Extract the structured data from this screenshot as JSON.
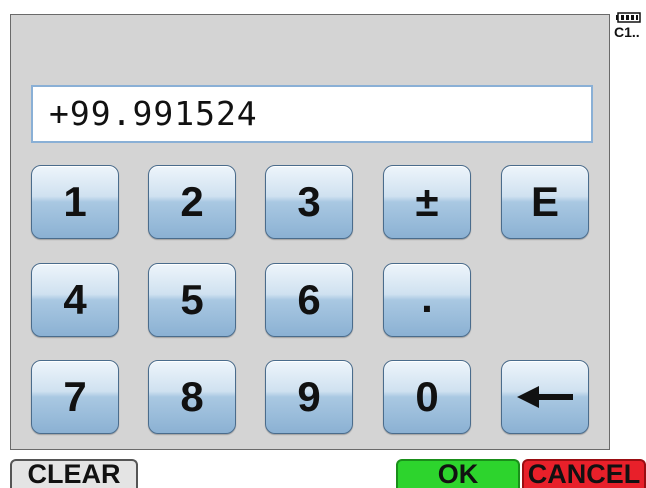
{
  "display": {
    "value": "+99.991524"
  },
  "keypad": {
    "k1": "1",
    "k2": "2",
    "k3": "3",
    "sign": "±",
    "exp": "E",
    "k4": "4",
    "k5": "5",
    "k6": "6",
    "dot": ".",
    "k7": "7",
    "k8": "8",
    "k9": "9",
    "k0": "0"
  },
  "status": {
    "channel_label": "C1.."
  },
  "footer": {
    "clear_label": "CLEAR",
    "ok_label": "OK",
    "cancel_label": "CANCEL"
  },
  "colors": {
    "ok": "#2dd42d",
    "cancel": "#e8202a",
    "key_top": "#eef5fb",
    "key_bottom": "#8bb1d3"
  }
}
